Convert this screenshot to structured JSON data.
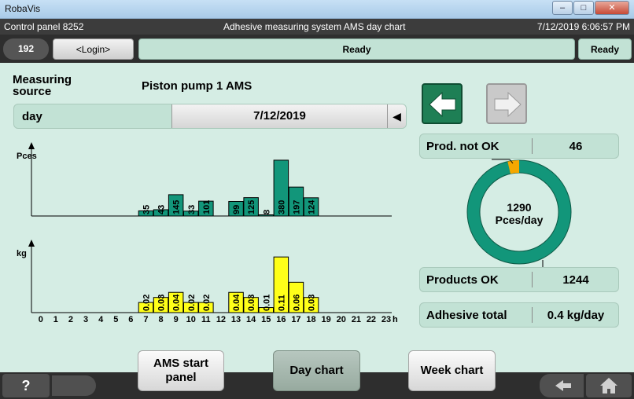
{
  "window": {
    "app_title": "RobaVis",
    "minimize": "–",
    "maximize": "□",
    "close": "✕"
  },
  "header": {
    "left": "Control panel 8252",
    "center": "Adhesive measuring system AMS day chart",
    "right": "7/12/2019 6:06:57 PM"
  },
  "status": {
    "id": "192",
    "login": "<Login>",
    "ready_main": "Ready",
    "ready_side": "Ready"
  },
  "measuring": {
    "label": "Measuring source",
    "source": "Piston pump 1 AMS"
  },
  "period": {
    "label": "day",
    "date": "7/12/2019",
    "arrow": "◀"
  },
  "info": {
    "not_ok_label": "Prod. not OK",
    "not_ok_value": "46",
    "ok_label": "Products OK",
    "ok_value": "1244",
    "adhesive_label": "Adhesive total",
    "adhesive_value": "0.4  kg/day",
    "ring_line1": "1290",
    "ring_line2": "Pces/day"
  },
  "buttons": {
    "ams_start": "AMS start panel",
    "day_chart": "Day chart",
    "week_chart": "Week chart",
    "help": "?"
  },
  "colors": {
    "teal": "#12967a",
    "yellow": "#ffff19",
    "background": "#d5ede4",
    "ring_notok": "#f5a800"
  },
  "chart_data": [
    {
      "type": "bar",
      "ylabel": "Pces",
      "xlabel": "h",
      "categories": [
        "7",
        "8",
        "9",
        "10",
        "11",
        "13",
        "14",
        "15",
        "16",
        "17",
        "18"
      ],
      "values": [
        35,
        43,
        145,
        33,
        101,
        99,
        125,
        8,
        380,
        197,
        124
      ],
      "x_ticks": [
        "0",
        "1",
        "2",
        "3",
        "4",
        "5",
        "6",
        "7",
        "8",
        "9",
        "10",
        "11",
        "12",
        "13",
        "14",
        "15",
        "16",
        "17",
        "18",
        "19",
        "20",
        "21",
        "22",
        "23"
      ]
    },
    {
      "type": "bar",
      "ylabel": "kg",
      "xlabel": "h",
      "categories": [
        "7",
        "8",
        "9",
        "10",
        "11",
        "13",
        "14",
        "15",
        "16",
        "17",
        "18"
      ],
      "values": [
        0.02,
        0.03,
        0.04,
        0.02,
        0.02,
        0.04,
        0.03,
        0.01,
        0.11,
        0.06,
        0.03
      ],
      "labels": [
        "0.02",
        "0.03",
        "0.04",
        "0.02",
        "0.02",
        "0.04",
        "0.03",
        "0.01",
        "0.11",
        "0.06",
        "0.03"
      ],
      "x_ticks": [
        "0",
        "1",
        "2",
        "3",
        "4",
        "5",
        "6",
        "7",
        "8",
        "9",
        "10",
        "11",
        "12",
        "13",
        "14",
        "15",
        "16",
        "17",
        "18",
        "19",
        "20",
        "21",
        "22",
        "23"
      ]
    }
  ]
}
